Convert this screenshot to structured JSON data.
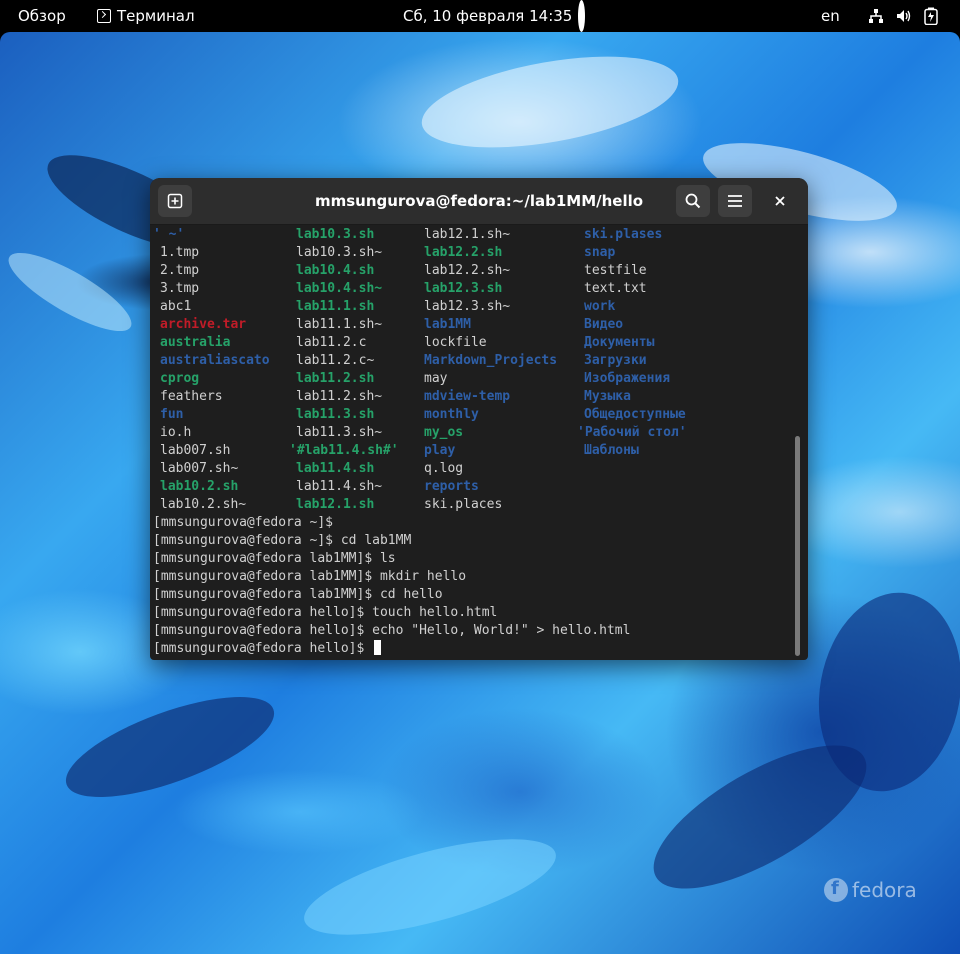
{
  "topbar": {
    "overview": "Обзор",
    "app_name": "Терминал",
    "clock": "Сб, 10 февраля  14:35",
    "lang": "en"
  },
  "window": {
    "title": "mmsungurova@fedora:~/lab1MM/hello"
  },
  "ls_columns": [
    [
      {
        "t": "' ~'",
        "c": "dir"
      },
      {
        "t": "1.tmp",
        "c": "plain"
      },
      {
        "t": "2.tmp",
        "c": "plain"
      },
      {
        "t": "3.tmp",
        "c": "plain"
      },
      {
        "t": "abc1",
        "c": "plain"
      },
      {
        "t": "archive.tar",
        "c": "arc"
      },
      {
        "t": "australia",
        "c": "exe"
      },
      {
        "t": "australiascato",
        "c": "dir"
      },
      {
        "t": "cprog",
        "c": "exe"
      },
      {
        "t": "feathers",
        "c": "plain"
      },
      {
        "t": "fun",
        "c": "dir"
      },
      {
        "t": "io.h",
        "c": "plain"
      },
      {
        "t": "lab007.sh",
        "c": "plain"
      },
      {
        "t": "lab007.sh~",
        "c": "plain"
      },
      {
        "t": "lab10.2.sh",
        "c": "exe"
      },
      {
        "t": "lab10.2.sh~",
        "c": "plain"
      }
    ],
    [
      {
        "t": "lab10.3.sh",
        "c": "exe"
      },
      {
        "t": "lab10.3.sh~",
        "c": "plain"
      },
      {
        "t": "lab10.4.sh",
        "c": "exe"
      },
      {
        "t": "lab10.4.sh~",
        "c": "exe"
      },
      {
        "t": "lab11.1.sh",
        "c": "exe"
      },
      {
        "t": "lab11.1.sh~",
        "c": "plain"
      },
      {
        "t": "lab11.2.c",
        "c": "plain"
      },
      {
        "t": "lab11.2.c~",
        "c": "plain"
      },
      {
        "t": "lab11.2.sh",
        "c": "exe"
      },
      {
        "t": "lab11.2.sh~",
        "c": "plain"
      },
      {
        "t": "lab11.3.sh",
        "c": "exe"
      },
      {
        "t": "lab11.3.sh~",
        "c": "plain"
      },
      {
        "t": "'#lab11.4.sh#'",
        "c": "exe"
      },
      {
        "t": "lab11.4.sh",
        "c": "exe"
      },
      {
        "t": "lab11.4.sh~",
        "c": "plain"
      },
      {
        "t": "lab12.1.sh",
        "c": "exe"
      }
    ],
    [
      {
        "t": "lab12.1.sh~",
        "c": "plain"
      },
      {
        "t": "lab12.2.sh",
        "c": "exe"
      },
      {
        "t": "lab12.2.sh~",
        "c": "plain"
      },
      {
        "t": "lab12.3.sh",
        "c": "exe"
      },
      {
        "t": "lab12.3.sh~",
        "c": "plain"
      },
      {
        "t": "lab1MM",
        "c": "dir"
      },
      {
        "t": "lockfile",
        "c": "plain"
      },
      {
        "t": "Markdown_Projects",
        "c": "dir"
      },
      {
        "t": "may",
        "c": "plain"
      },
      {
        "t": "mdview-temp",
        "c": "dir"
      },
      {
        "t": "monthly",
        "c": "dir"
      },
      {
        "t": "my_os",
        "c": "exe"
      },
      {
        "t": "play",
        "c": "dir"
      },
      {
        "t": "q.log",
        "c": "plain"
      },
      {
        "t": "reports",
        "c": "dir"
      },
      {
        "t": "ski.places",
        "c": "plain"
      }
    ],
    [
      {
        "t": "ski.plases",
        "c": "dir"
      },
      {
        "t": "snap",
        "c": "dir"
      },
      {
        "t": "testfile",
        "c": "plain"
      },
      {
        "t": "text.txt",
        "c": "plain"
      },
      {
        "t": "work",
        "c": "dir"
      },
      {
        "t": "Видео",
        "c": "dir"
      },
      {
        "t": "Документы",
        "c": "dir"
      },
      {
        "t": "Загрузки",
        "c": "dir"
      },
      {
        "t": "Изображения",
        "c": "dir"
      },
      {
        "t": "Музыка",
        "c": "dir"
      },
      {
        "t": "Общедоступные",
        "c": "dir"
      },
      {
        "t": "'Рабочий стол'",
        "c": "dir"
      },
      {
        "t": "Шаблоны",
        "c": "dir"
      }
    ]
  ],
  "prompt_lines": [
    "[mmsungurova@fedora ~]$",
    "[mmsungurova@fedora ~]$ cd lab1MM",
    "[mmsungurova@fedora lab1MM]$ ls",
    "[mmsungurova@fedora lab1MM]$ mkdir hello",
    "[mmsungurova@fedora lab1MM]$ cd hello",
    "[mmsungurova@fedora hello]$ touch hello.html",
    "[mmsungurova@fedora hello]$ echo \"Hello, World!\" > hello.html",
    "[mmsungurova@fedora hello]$ "
  ],
  "colors": {
    "dir": "#2e5fa8",
    "exe": "#26a269",
    "archive": "#c01c28",
    "terminal_bg": "#1e1e1e"
  },
  "wallpaper_logo": "fedora"
}
